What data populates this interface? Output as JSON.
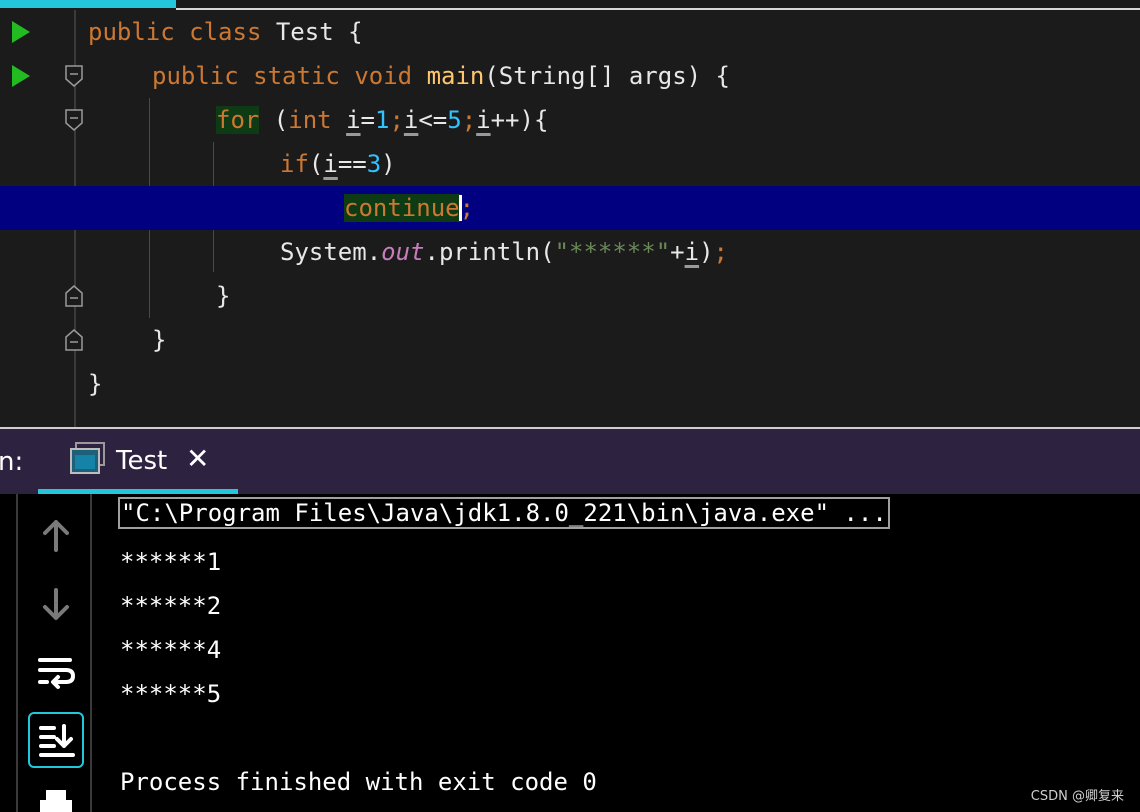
{
  "editor": {
    "lines": {
      "l1": {
        "kw_public": "public",
        "kw_class": "class",
        "class_name": " Test {"
      },
      "l2": {
        "kw_public": "public",
        "kw_static": "static",
        "kw_void": "void",
        "method": "main",
        "params": "(String[] args) {"
      },
      "l3": {
        "kw_for": "for",
        "open": " (",
        "kw_int": "int",
        "sp": " ",
        "var1": "i",
        "eq": "=",
        "n1": "1",
        "semi1": ";",
        "var2": "i",
        "le": "<=",
        "n5": "5",
        "semi2": ";",
        "var3": "i",
        "rest": "++){"
      },
      "l4": {
        "kw_if": "if",
        "open": "(",
        "var": "i",
        "eqeq": "==",
        "n3": "3",
        "close": ")"
      },
      "l5": {
        "kw_continue": "continue",
        "semi": ";"
      },
      "l6": {
        "sys": "System.",
        "out": "out",
        "println": ".println(",
        "str": "\"******\"",
        "plus": "+",
        "var": "i",
        "close": ")",
        "semi": ";"
      },
      "l7": {
        "brace": "}"
      },
      "l8": {
        "brace": "}"
      },
      "l9": {
        "brace": "}"
      }
    }
  },
  "run_panel": {
    "label": "n:",
    "tab": {
      "label": "Test",
      "close": "✕"
    },
    "toolbar": [
      "arrow-up-icon",
      "arrow-down-icon",
      "soft-wrap-icon",
      "scroll-to-end-icon",
      "print-icon"
    ],
    "console": {
      "command": "\"C:\\Program Files\\Java\\jdk1.8.0_221\\bin\\java.exe\" ...",
      "output": [
        "******1",
        "******2",
        "******4",
        "******5"
      ],
      "exit": "Process finished with exit code 0"
    }
  },
  "watermark": "CSDN @卿复来",
  "colors": {
    "accent": "#24c6dc",
    "keyword": "#cc7832",
    "number": "#2fc3ff",
    "string": "#6a8759",
    "highlight": "#000080"
  }
}
